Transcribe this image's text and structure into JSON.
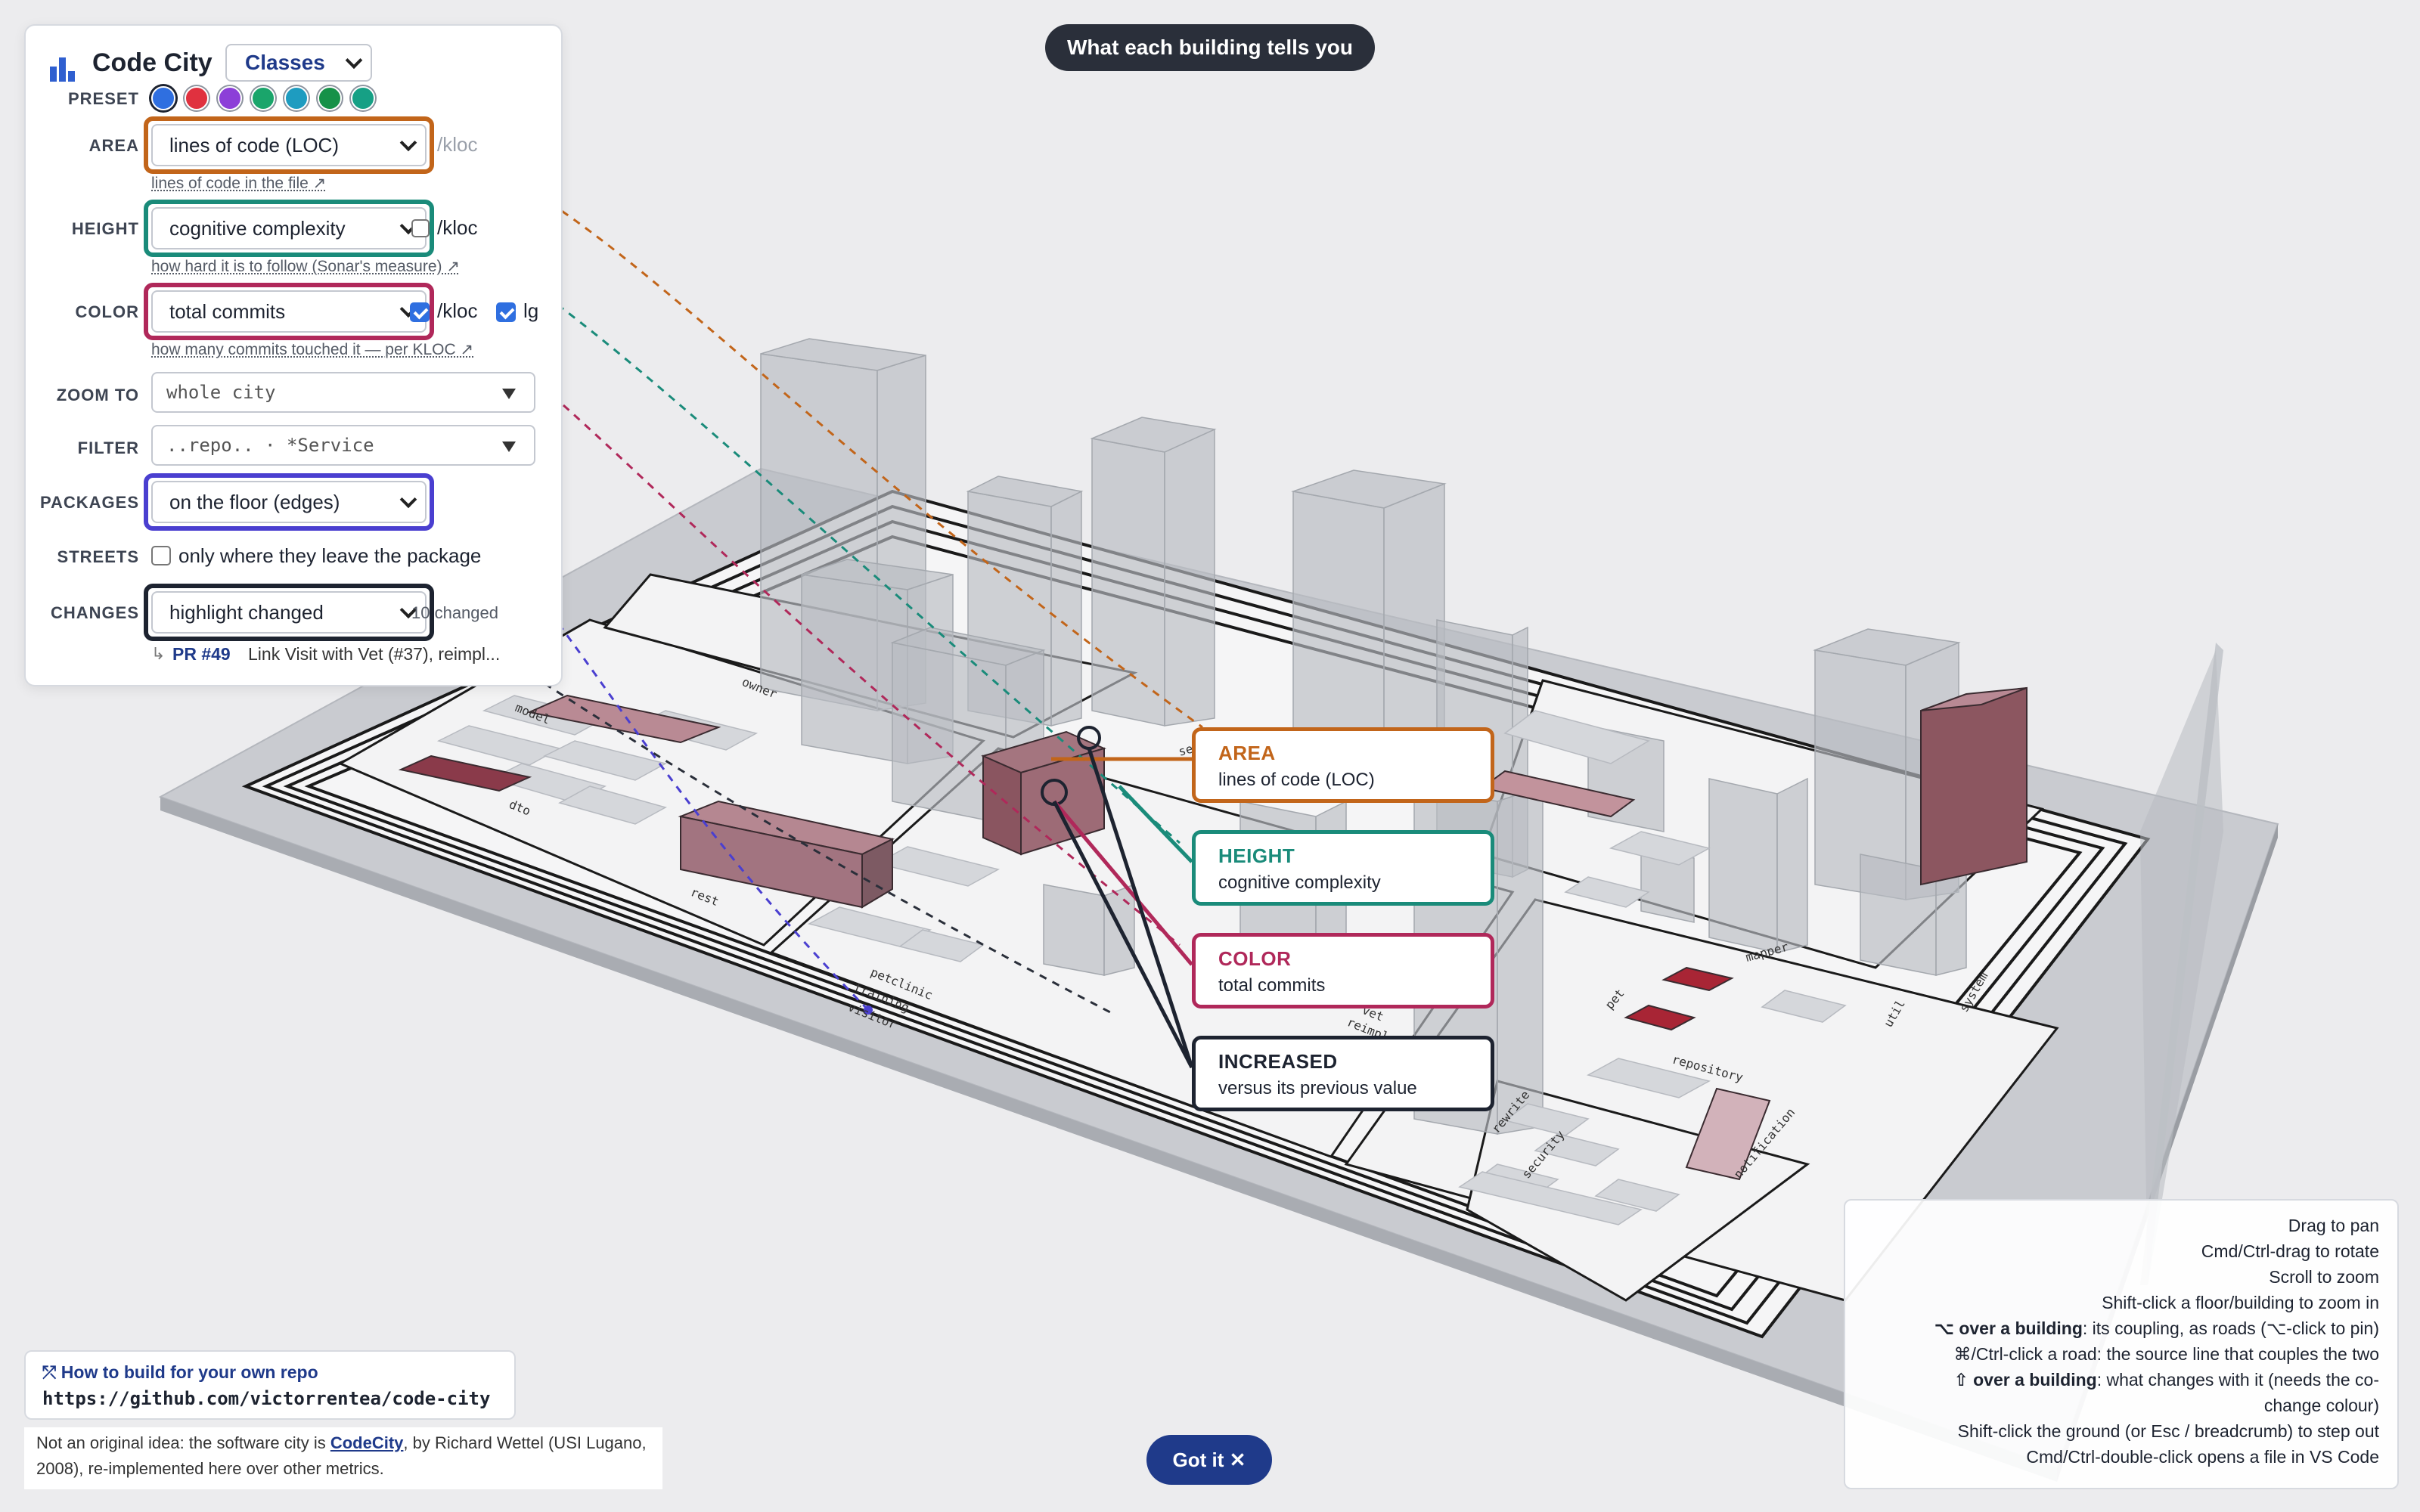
{
  "app": {
    "title": "Code City",
    "scope_select": "Classes",
    "logo_icon": "bar-chart-icon"
  },
  "top_pill": "What each building tells you",
  "preset": {
    "label": "PRESET",
    "swatches": [
      "#2f6fe0",
      "#e0313f",
      "#8c3fd8",
      "#1aa56b",
      "#1e9cc0",
      "#169148",
      "#16a085"
    ]
  },
  "controls": {
    "area": {
      "label": "AREA",
      "value": "lines of code (LOC)",
      "suffix": "/kloc",
      "hint": "lines of code in the file ↗"
    },
    "height": {
      "label": "HEIGHT",
      "value": "cognitive complexity",
      "suffix": "/kloc",
      "hint": "how hard it is to follow (Sonar's measure) ↗"
    },
    "color": {
      "label": "COLOR",
      "value": "total commits",
      "suffix": "/kloc",
      "lg_label": "lg",
      "hint": "how many commits touched it — per KLOC ↗"
    },
    "zoom_to": {
      "label": "ZOOM TO",
      "value": "whole city"
    },
    "filter": {
      "label": "FILTER",
      "placeholder": "..repo.. · *Service"
    },
    "packages": {
      "label": "PACKAGES",
      "value": "on the floor (edges)"
    },
    "streets": {
      "label": "STREETS",
      "text": "only where they leave the package"
    },
    "changes": {
      "label": "CHANGES",
      "value": "highlight changed",
      "count": "10 changed"
    },
    "pr": {
      "arrow": "↳",
      "id": "PR  #49",
      "text": "Link Visit with Vet (#37), reimpl..."
    }
  },
  "callouts": {
    "area": {
      "head": "AREA",
      "sub": "lines of code (LOC)"
    },
    "height": {
      "head": "HEIGHT",
      "sub": "cognitive complexity"
    },
    "color": {
      "head": "COLOR",
      "sub": "total commits"
    },
    "increased": {
      "head": "INCREASED",
      "sub": "versus its previous value"
    }
  },
  "help": {
    "lines": [
      {
        "bold": "",
        "text": "Drag to pan"
      },
      {
        "bold": "",
        "text": "Cmd/Ctrl-drag to rotate"
      },
      {
        "bold": "",
        "text": "Scroll to zoom"
      },
      {
        "bold": "",
        "text": "Shift-click a floor/building to zoom in"
      },
      {
        "bold": "⌥ over a building",
        "text": ": its coupling, as roads (⌥-click to pin)"
      },
      {
        "bold": "",
        "text": "⌘/Ctrl-click a road: the source line that couples the two"
      },
      {
        "bold": "⇧ over a building",
        "text": ": what changes with it (needs the co-"
      },
      {
        "bold": "",
        "text": "change colour)"
      },
      {
        "bold": "",
        "text": "Shift-click the ground (or Esc / breadcrumb) to step out"
      },
      {
        "bold": "",
        "text": "Cmd/Ctrl-double-click opens a file in VS Code"
      }
    ]
  },
  "howto": {
    "title": "⤱ How to build for your own repo",
    "url": "https://github.com/victorrentea/code-city"
  },
  "credit": {
    "pre": "Not an original idea: the software city is ",
    "link": "CodeCity",
    "post": ", by Richard Wettel (USI Lugano, 2008), re-implemented here over other metrics."
  },
  "got_it": "Got it ✕",
  "city_labels": [
    "rest",
    "petclinic",
    "training",
    "visitor",
    "dto",
    "model",
    "owner",
    "vet",
    "mapper",
    "repository",
    "security",
    "notification",
    "reimpl",
    "rewrite",
    "service",
    "system",
    "pet",
    "util"
  ],
  "colors": {
    "area": "#c2651a",
    "height": "#1a8b7a",
    "color": "#b0285a",
    "increased": "#1d2330",
    "packages": "#4a3fd0",
    "changed_building": "#8a5560",
    "hot_building": "#a82535"
  }
}
